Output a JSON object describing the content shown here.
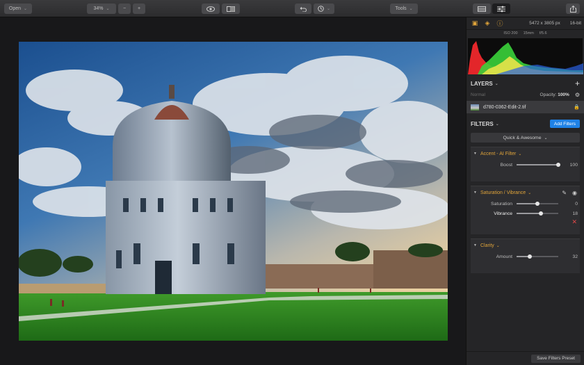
{
  "toolbar": {
    "open_label": "Open",
    "zoom_value": "34%",
    "minus_label": "−",
    "plus_label": "+",
    "tools_label": "Tools",
    "icons": [
      "eye-icon",
      "compare-icon",
      "undo-icon",
      "history-icon",
      "layers-panel-icon",
      "filters-panel-icon",
      "share-icon"
    ]
  },
  "panel": {
    "dimensions": "5472 x 3805 px",
    "bit_depth": "16-bit",
    "exif": {
      "iso": "ISO 200",
      "focal": "15mm",
      "aperture": "f/5.6"
    },
    "layers": {
      "title": "LAYERS",
      "add": "+",
      "blend_mode": "Normal",
      "opacity_label": "Opacity:",
      "opacity_value": "100%",
      "layer_name": "d780-0362-Edit-2.tif"
    },
    "filters": {
      "title": "FILTERS",
      "add_button": "Add Filters",
      "preset": "Quick & Awesome",
      "items": [
        {
          "name": "Accent - AI Filter",
          "sliders": [
            {
              "label": "Boost",
              "value": "100",
              "level": 1.0
            }
          ]
        },
        {
          "name": "Saturation / Vibrance",
          "sliders": [
            {
              "label": "Saturation",
              "value": "0",
              "level": 0.5
            },
            {
              "label": "Vibrance",
              "value": "18",
              "level": 0.59
            }
          ]
        },
        {
          "name": "Clarity",
          "sliders": [
            {
              "label": "Amount",
              "value": "32",
              "level": 0.32
            }
          ]
        }
      ]
    },
    "save_preset": "Save Filters Preset"
  },
  "colors": {
    "accent_orange": "#e0a43a",
    "accent_blue": "#1f82e6",
    "remove_red": "#e04848"
  }
}
